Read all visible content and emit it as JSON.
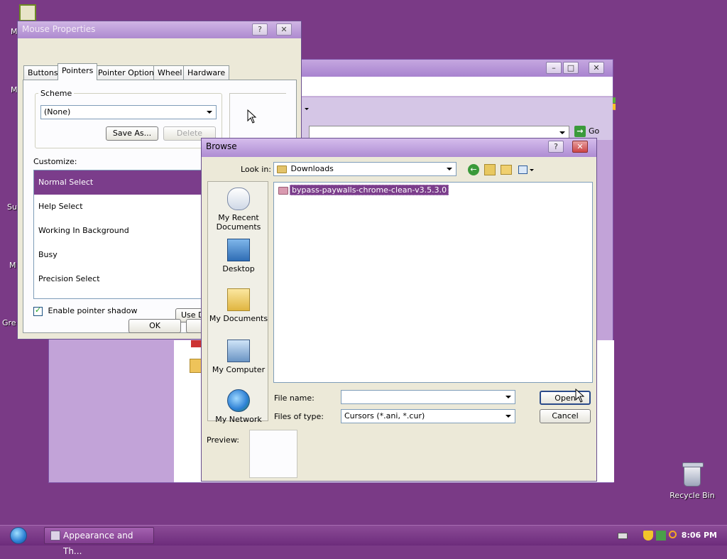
{
  "desktop": {
    "labels": [
      "M",
      "M",
      "Su",
      "M",
      "Gre"
    ],
    "recycle_bin": "Recycle Bin"
  },
  "background_window": {
    "go_label": "Go"
  },
  "mouse_properties": {
    "title": "Mouse Properties",
    "tabs": [
      "Buttons",
      "Pointers",
      "Pointer Options",
      "Wheel",
      "Hardware"
    ],
    "active_tab": "Pointers",
    "scheme_label": "Scheme",
    "scheme_value": "(None)",
    "save_as": "Save As...",
    "delete": "Delete",
    "customize_label": "Customize:",
    "pointers": [
      "Normal Select",
      "Help Select",
      "Working In Background",
      "Busy",
      "Precision Select"
    ],
    "selected_pointer": "Normal Select",
    "enable_shadow": "Enable pointer shadow",
    "enable_shadow_checked": true,
    "use_default": "Use D",
    "ok": "OK"
  },
  "browse": {
    "title": "Browse",
    "look_in_label": "Look in:",
    "look_in_value": "Downloads",
    "places": [
      "My Recent Documents",
      "Desktop",
      "My Documents",
      "My Computer",
      "My Network"
    ],
    "files": [
      "bypass-paywalls-chrome-clean-v3.5.3.0"
    ],
    "file_name_label": "File name:",
    "file_name_value": "",
    "files_of_type_label": "Files of type:",
    "files_of_type_value": "Cursors (*.ani, *.cur)",
    "open": "Open",
    "cancel": "Cancel",
    "preview_label": "Preview:"
  },
  "taskbar": {
    "task_button": "Appearance and Th...",
    "clock": "8:06 PM"
  },
  "colors": {
    "desktop": "#7a3a86",
    "selection": "#7b3d8b",
    "dialog_bg": "#ece9d8"
  }
}
